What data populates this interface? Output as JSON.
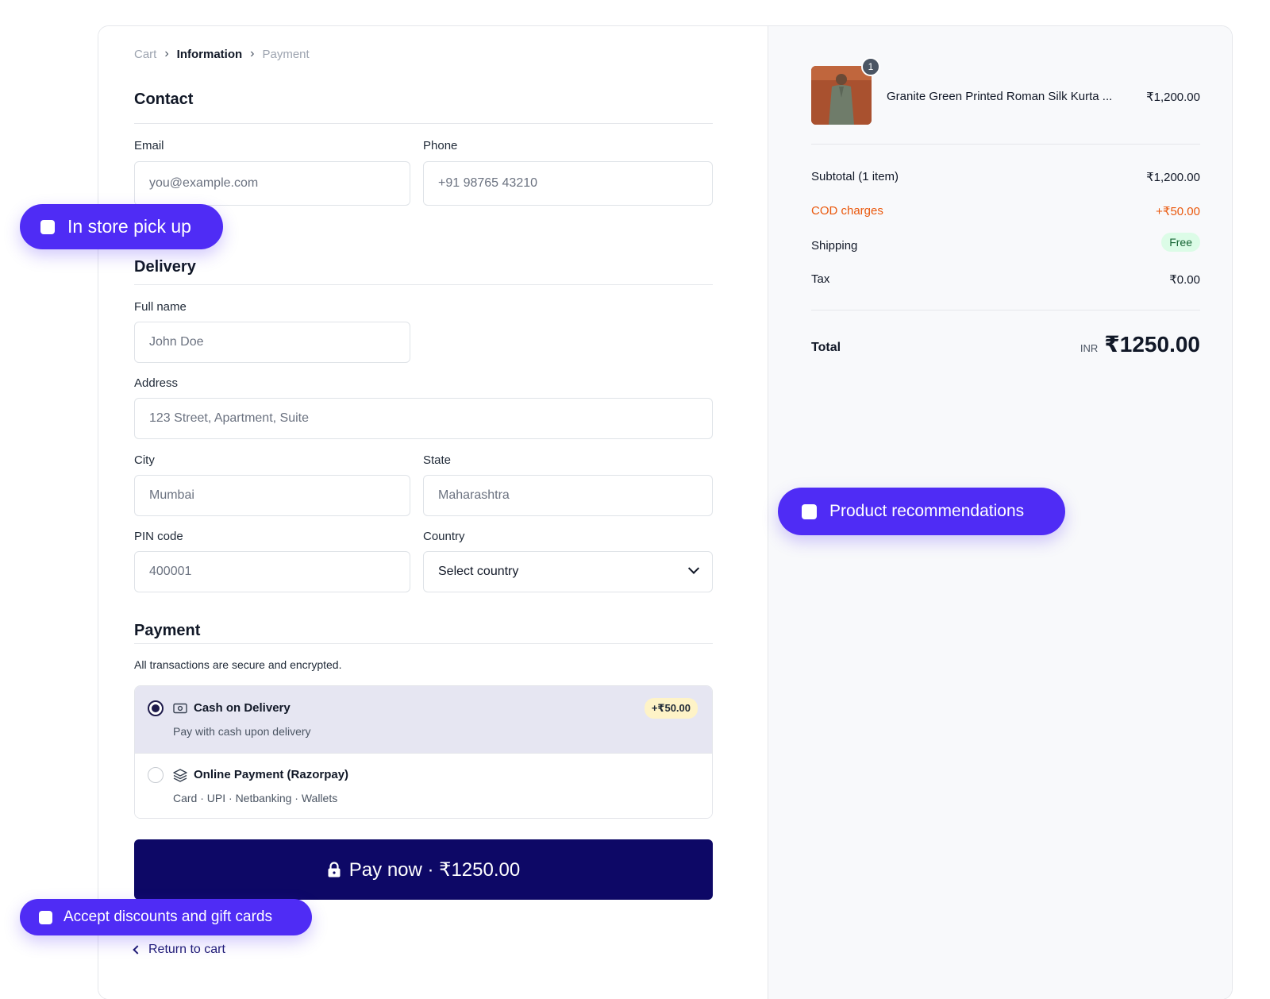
{
  "breadcrumb": {
    "items": [
      "Cart",
      "Information",
      "Payment"
    ],
    "separator": "›"
  },
  "contact": {
    "title": "Contact",
    "email_label": "Email",
    "email_placeholder": "you@example.com",
    "phone_label": "Phone",
    "phone_placeholder": "+91 98765 43210"
  },
  "delivery": {
    "title": "Delivery",
    "fullname_label": "Full name",
    "fullname_placeholder": "John Doe",
    "address_label": "Address",
    "address_placeholder": "123 Street, Apartment, Suite",
    "city_label": "City",
    "city_placeholder": "Mumbai",
    "state_label": "State",
    "state_placeholder": "Maharashtra",
    "pin_label": "PIN code",
    "pin_placeholder": "400001",
    "country_label": "Country",
    "country_value": "Select country"
  },
  "payment": {
    "title": "Payment",
    "secure_note": "All transactions are secure and encrypted.",
    "options": [
      {
        "title": "Cash on Delivery",
        "subtitle": "Pay with cash upon delivery",
        "fee": "+₹50.00",
        "selected": true,
        "icon": "cash-icon"
      },
      {
        "title": "Online Payment (Razorpay)",
        "subtitle": "Card · UPI · Netbanking · Wallets",
        "selected": false,
        "icon": "layers-icon"
      }
    ],
    "pay_button": "Pay now · ₹1250.00",
    "return_link": "Return to cart"
  },
  "summary": {
    "item": {
      "name": "Granite Green Printed Roman Silk Kurta ...",
      "price": "₹1,200.00",
      "quantity": "1"
    },
    "subtotal_label": "Subtotal (1 item)",
    "subtotal_value": "₹1,200.00",
    "cod_label": "COD charges",
    "cod_value": "+₹50.00",
    "shipping_label": "Shipping",
    "shipping_value": "Free",
    "tax_label": "Tax",
    "tax_value": "₹0.00",
    "total_label": "Total",
    "total_currency": "INR",
    "total_value": "₹1250.00"
  },
  "pills": {
    "store_pickup": "In store pick up",
    "recommendations": "Product recommendations",
    "discounts": "Accept discounts and gift cards"
  },
  "colors": {
    "accent": "#4f2cf5",
    "pay_button": "#0d0866",
    "cod": "#ea580c",
    "free_badge": "#dcfce7"
  }
}
